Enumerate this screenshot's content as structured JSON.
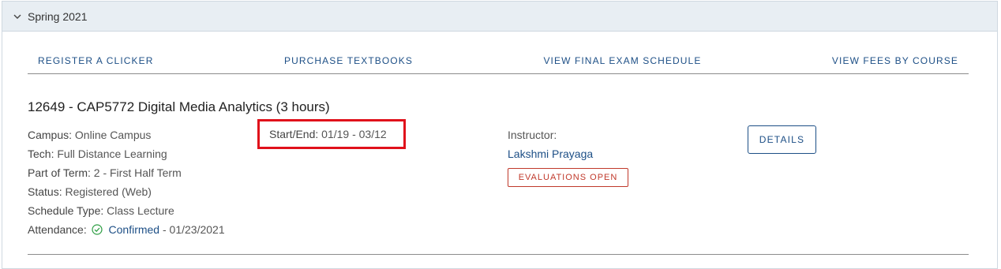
{
  "term": {
    "label": "Spring 2021",
    "toggle_icon": "chevron-down-icon"
  },
  "links": [
    "REGISTER A CLICKER",
    "PURCHASE TEXTBOOKS",
    "VIEW FINAL EXAM SCHEDULE",
    "VIEW FEES BY COURSE"
  ],
  "course": {
    "title": "12649 - CAP5772 Digital Media Analytics (3 hours)",
    "campus_label": "Campus:",
    "campus": "Online Campus",
    "tech_label": "Tech:",
    "tech": "Full Distance Learning",
    "part_label": "Part of Term:",
    "part": "2 - First Half Term",
    "status_label": "Status:",
    "status": "Registered (Web)",
    "schedule_label": "Schedule Type:",
    "schedule": "Class Lecture",
    "attendance_label": "Attendance:",
    "attendance_status": "Confirmed",
    "attendance_date": "- 01/23/2021",
    "startend_label": "Start/End:",
    "startend": "01/19 - 03/12",
    "instructor_label": "Instructor:",
    "instructor": "Lakshmi Prayaga",
    "evaluations_button": "EVALUATIONS OPEN",
    "details_button": "DETAILS"
  },
  "colors": {
    "link": "#1d4f86",
    "highlight": "#e0111b",
    "evaluation": "#c0392b",
    "confirm": "#2e9e44"
  }
}
